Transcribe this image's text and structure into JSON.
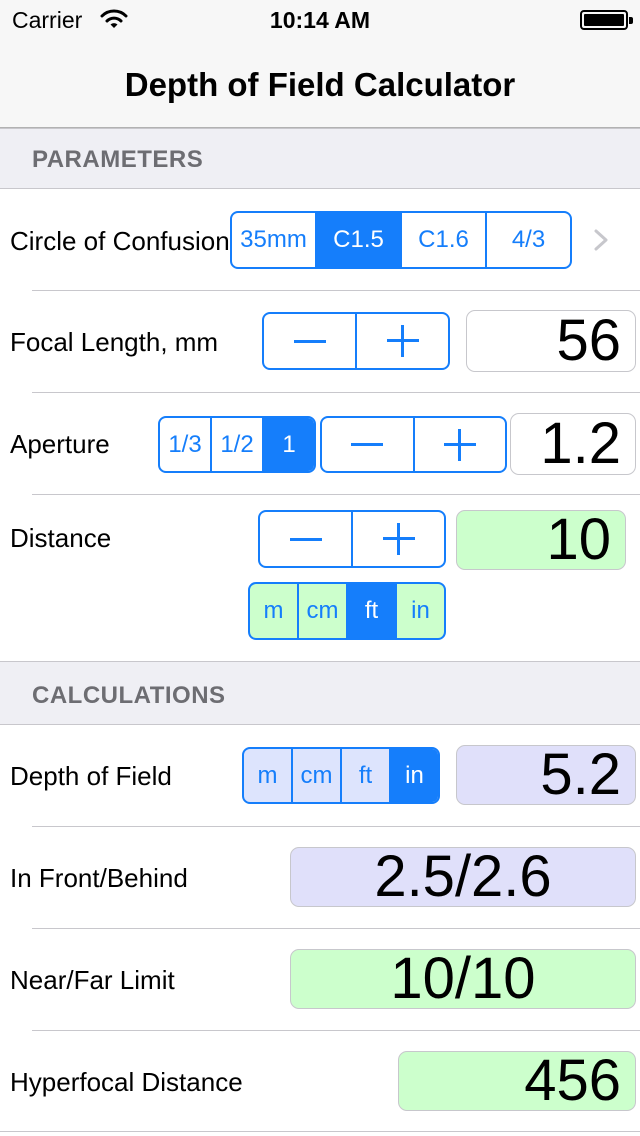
{
  "status_bar": {
    "carrier": "Carrier",
    "time": "10:14 AM"
  },
  "nav": {
    "title": "Depth of Field Calculator"
  },
  "parameters": {
    "header": "PARAMETERS",
    "circle_of_confusion": {
      "label": "Circle of Confusion",
      "options": [
        "35mm",
        "C1.5",
        "C1.6",
        "4/3"
      ],
      "selected": "C1.5"
    },
    "focal_length": {
      "label": "Focal Length, mm",
      "value": "56"
    },
    "aperture": {
      "label": "Aperture",
      "step_options": [
        "1/3",
        "1/2",
        "1"
      ],
      "selected": "1",
      "value": "1.2"
    },
    "distance": {
      "label": "Distance",
      "value": "10",
      "units": [
        "m",
        "cm",
        "ft",
        "in"
      ],
      "selected_unit": "ft"
    }
  },
  "calculations": {
    "header": "CALCULATIONS",
    "depth_of_field": {
      "label": "Depth of Field",
      "units": [
        "m",
        "cm",
        "ft",
        "in"
      ],
      "selected_unit": "in",
      "value": "5.2"
    },
    "in_front_behind": {
      "label": "In Front/Behind",
      "value": "2.5/2.6"
    },
    "near_far_limit": {
      "label": "Near/Far Limit",
      "value": "10/10"
    },
    "hyperfocal_distance": {
      "label": "Hyperfocal Distance",
      "value": "456"
    }
  },
  "colors": {
    "accent": "#157efb",
    "input_green": "#ccffcc",
    "output_blue": "#e0e0fa",
    "section_bg": "#efeff4"
  },
  "icons": {
    "wifi": "wifi-icon",
    "battery": "battery-icon",
    "disclosure": "chevron-right-icon",
    "decrement": "minus-icon",
    "increment": "plus-icon"
  }
}
